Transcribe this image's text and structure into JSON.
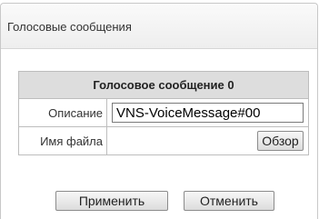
{
  "panel": {
    "title": "Голосовые сообщения"
  },
  "table": {
    "header": "Голосовое сообщение 0",
    "rows": [
      {
        "label": "Описание",
        "value": "VNS-VoiceMessage#00"
      },
      {
        "label": "Имя файла",
        "button": "Обзор"
      }
    ]
  },
  "actions": {
    "apply_label": "Применить",
    "cancel_label": "Отменить"
  }
}
